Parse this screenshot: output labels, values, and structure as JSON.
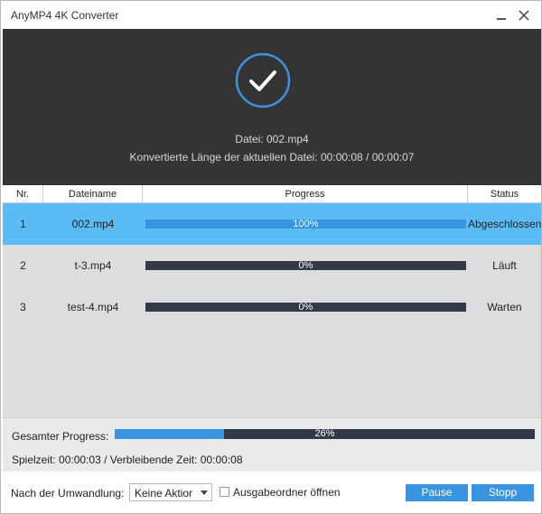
{
  "window": {
    "title": "AnyMP4 4K Converter"
  },
  "banner": {
    "file_line": "Datei: 002.mp4",
    "length_line": "Konvertierte Länge der aktuellen Datei: 00:00:08 / 00:00:07",
    "icon": "check-circle-icon"
  },
  "table": {
    "headers": [
      "Nr.",
      "Dateiname",
      "Progress",
      "Status"
    ],
    "rows": [
      {
        "nr": "1",
        "name": "002.mp4",
        "progress": 1.0,
        "progress_label": "100%",
        "status": "Abgeschlossen",
        "selected": true
      },
      {
        "nr": "2",
        "name": "t-3.mp4",
        "progress": 0.0,
        "progress_label": "0%",
        "status": "Läuft",
        "selected": false
      },
      {
        "nr": "3",
        "name": "test-4.mp4",
        "progress": 0.0,
        "progress_label": "0%",
        "status": "Warten",
        "selected": false
      }
    ]
  },
  "total": {
    "label": "Gesamter Progress:",
    "progress": 0.26,
    "progress_label": "26%",
    "time_line": "Spielzeit: 00:00:03 / Verbleibende Zeit: 00:00:08"
  },
  "footer": {
    "after_label": "Nach der Umwandlung:",
    "after_value": "Keine Aktior",
    "open_folder_label": "Ausgabeordner öffnen",
    "open_folder_checked": false,
    "pause_label": "Pause",
    "stop_label": "Stopp"
  },
  "colors": {
    "accent": "#3a94e0",
    "selected_row": "#5bbcf5",
    "banner_bg": "#343434",
    "bar_track": "#333a47"
  }
}
